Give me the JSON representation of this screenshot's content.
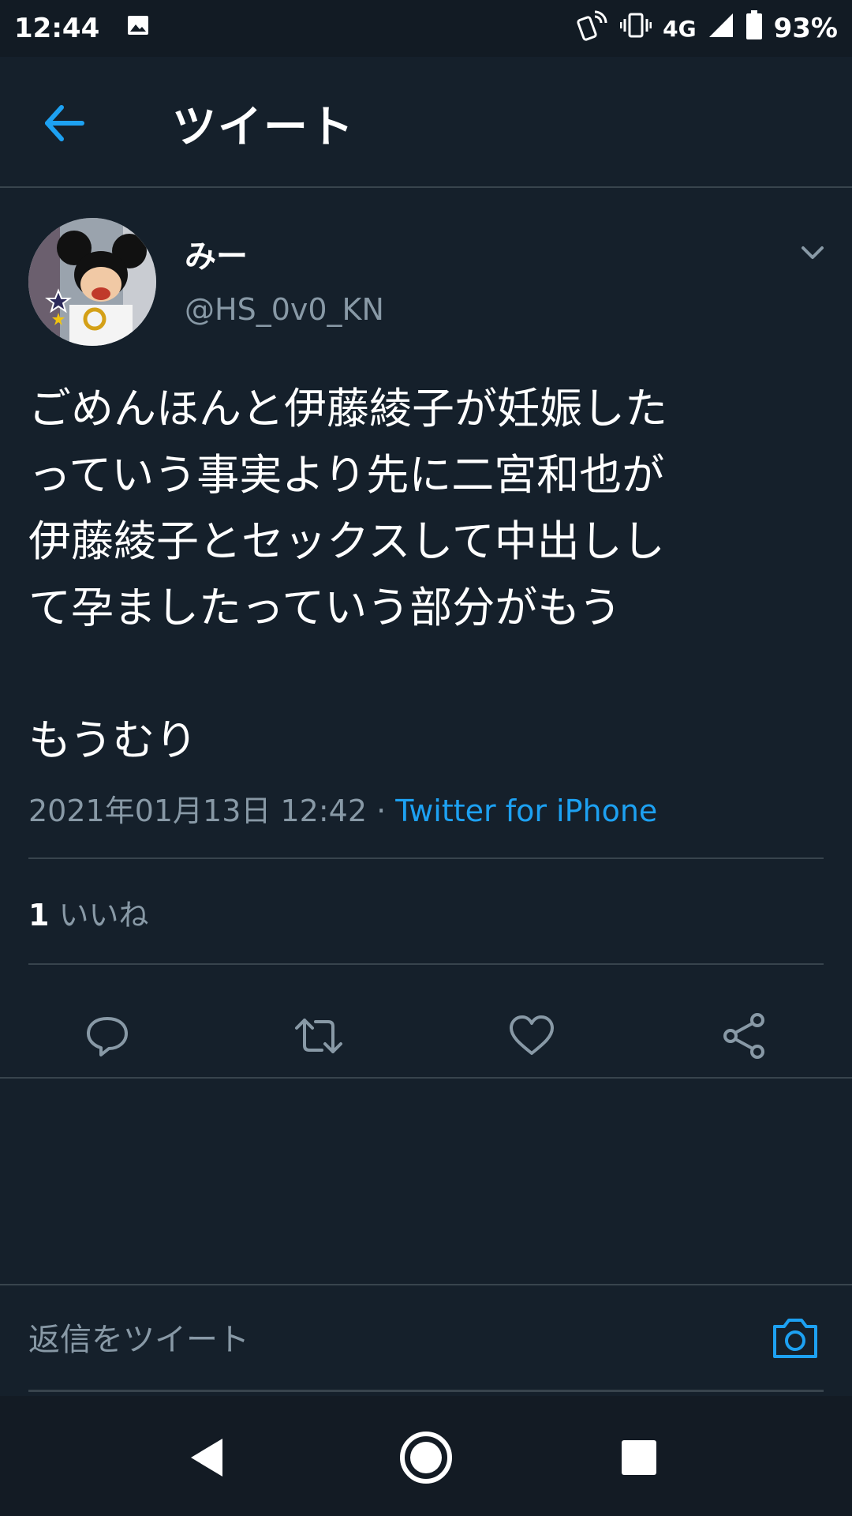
{
  "status_bar": {
    "time": "12:44",
    "network": "4G",
    "battery": "93%",
    "icons": [
      "image-icon",
      "nfc-icon",
      "vibrate-icon",
      "signal-icon",
      "battery-icon"
    ]
  },
  "header": {
    "title": "ツイート",
    "back_icon": "arrow-left-icon",
    "accent_color": "#1da1f2"
  },
  "tweet": {
    "user_name": "みー",
    "handle": "@HS_0v0_KN",
    "text": "ごめんほんと伊藤綾子が妊娠した\nっていう事実より先に二宮和也が\n伊藤綾子とセックスして中出しし\nて孕ましたっていう部分がもう\n\nもうむり",
    "timestamp": "2021年01月13日 12:42",
    "separator": " · ",
    "source": "Twitter for iPhone",
    "likes_count": "1",
    "likes_label": "いいね"
  },
  "actions": [
    "reply-icon",
    "retweet-icon",
    "like-icon",
    "share-icon"
  ],
  "reply": {
    "placeholder": "返信をツイート"
  },
  "nav": [
    "back-triangle-icon",
    "home-circle-icon",
    "recents-square-icon"
  ]
}
